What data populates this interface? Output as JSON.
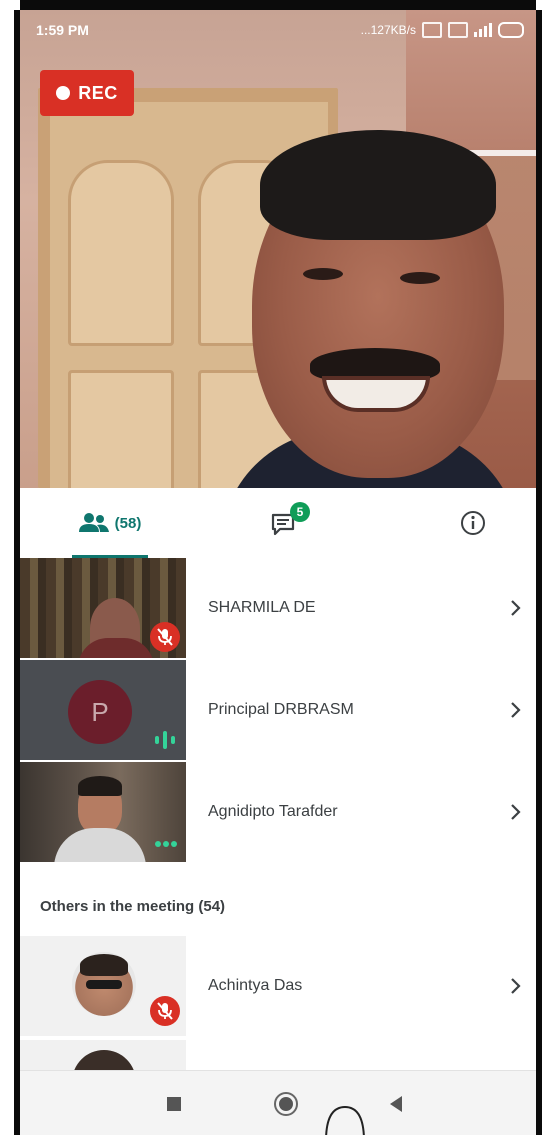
{
  "status_bar": {
    "time": "1:59 PM",
    "network": "...127KB/s"
  },
  "recording": {
    "label": "REC"
  },
  "tabs": {
    "people_count": "(58)",
    "chat_badge": "5"
  },
  "participants": [
    {
      "name": "SHARMILA DE",
      "state": "muted"
    },
    {
      "name": "Principal DRBRASM",
      "avatar_initial": "P",
      "state": "speaking"
    },
    {
      "name": "Agnidipto Tarafder",
      "state": "active"
    }
  ],
  "others_section": {
    "title": "Others in the meeting (54)",
    "items": [
      {
        "name": "Achintya Das",
        "state": "muted"
      }
    ]
  },
  "colors": {
    "accent": "#0f766e",
    "rec_red": "#d93025",
    "badge_green": "#0f9d58"
  },
  "icons": {
    "people": "people-icon",
    "chat": "chat-icon",
    "info": "info-icon",
    "chevron": "chevron-right-icon",
    "mic_off": "mic-off-icon",
    "audio_wave": "audio-level-icon",
    "nav_recent": "recent-apps-icon",
    "nav_home": "home-icon",
    "nav_back": "back-icon"
  }
}
